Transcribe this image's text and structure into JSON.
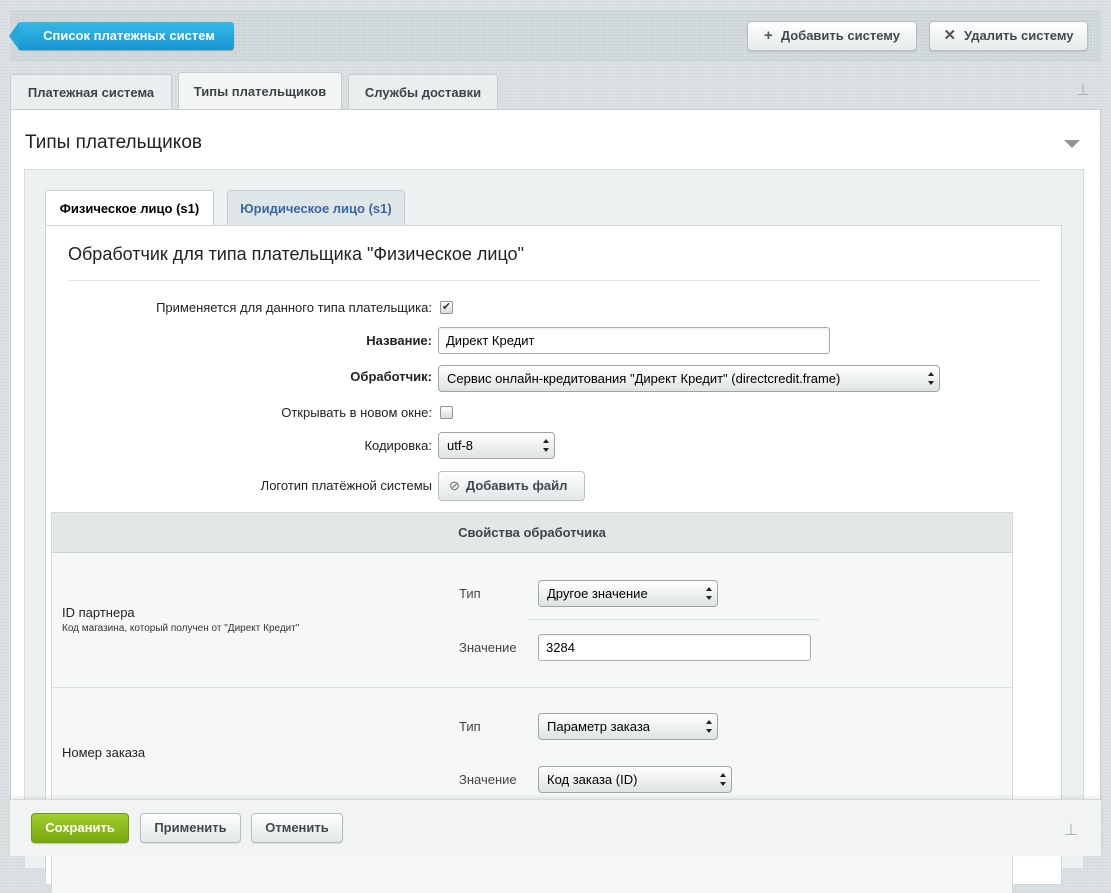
{
  "toolbar": {
    "back_label": "Список платежных систем",
    "add_label": "Добавить систему",
    "delete_label": "Удалить систему",
    "add_icon": "plus-icon",
    "delete_icon": "x-icon"
  },
  "tabs": [
    {
      "label": "Платежная система",
      "active": false
    },
    {
      "label": "Типы плательщиков",
      "active": true
    },
    {
      "label": "Службы доставки",
      "active": false
    }
  ],
  "section": {
    "title": "Типы плательщиков",
    "subtabs": [
      {
        "label": "Физическое лицо (s1)",
        "active": true
      },
      {
        "label": "Юридическое лицо (s1)",
        "active": false
      }
    ],
    "heading": "Обработчик для типа плательщика \"Физическое лицо\"",
    "form": {
      "applies_label": "Применяется для данного типа плательщика:",
      "applies_checked": true,
      "name_label": "Название:",
      "name_value": "Директ Кредит",
      "handler_label": "Обработчик:",
      "handler_value": "Сервис онлайн-кредитования \"Директ Кредит\" (directcredit.frame)",
      "new_window_label": "Открывать в новом окне:",
      "new_window_checked": false,
      "encoding_label": "Кодировка:",
      "encoding_value": "utf-8",
      "logo_label": "Логотип платёжной системы",
      "add_file_label": "Добавить файл",
      "add_file_icon": "paperclip-icon"
    },
    "props": {
      "header": "Свойства обработчика",
      "rows": [
        {
          "name": "ID партнера",
          "desc": "Код магазина, который получен от \"Директ Кредит\"",
          "type_label": "Тип",
          "type_value": "Другое значение",
          "value_label": "Значение",
          "value": "3284"
        },
        {
          "name": "Номер заказа",
          "desc": "",
          "type_label": "Тип",
          "type_value": "Параметр заказа",
          "value_label": "Значение",
          "value": "Код заказа (ID)"
        }
      ]
    }
  },
  "footer": {
    "save_label": "Сохранить",
    "apply_label": "Применить",
    "cancel_label": "Отменить"
  },
  "colors": {
    "back_button": "#1fa6dc",
    "save_button": "#8cbc1f",
    "subtab_inactive_text": "#3a66a8"
  }
}
